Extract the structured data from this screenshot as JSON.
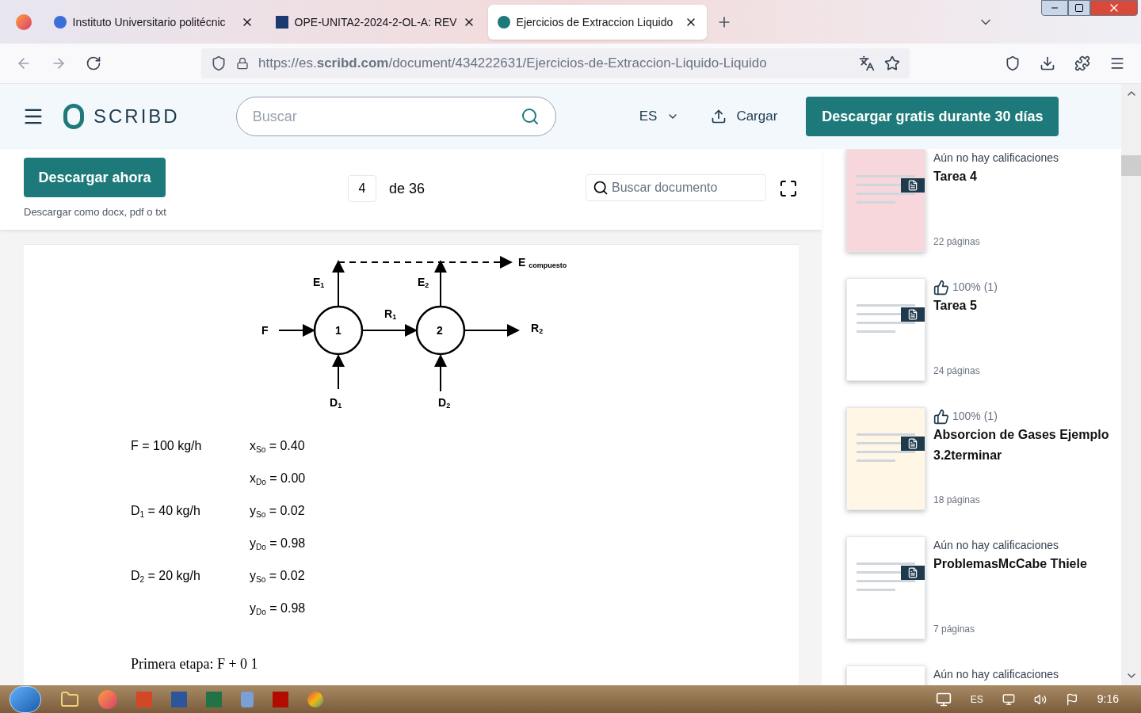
{
  "browser": {
    "tabs": [
      {
        "title": "Instituto Universitario politécnic",
        "selected": false
      },
      {
        "title": "OPE-UNITA2-2024-2-OL-A: REV",
        "selected": false
      },
      {
        "title": "Ejercicios de Extraccion Liquido",
        "selected": true
      }
    ],
    "url": "https://es.**scribd.com**/document/434222631/Ejercicios-de-Extraccion-Liquido-Liquido"
  },
  "header": {
    "logo": "SCRIBD",
    "search_placeholder": "Buscar",
    "language": "ES",
    "upload": "Cargar",
    "cta": "Descargar gratis durante 30 días"
  },
  "toolbar": {
    "download": "Descargar ahora",
    "download_note": "Descargar como docx, pdf o txt",
    "page": "4",
    "page_total": "de 36",
    "doc_search_placeholder": "Buscar documento"
  },
  "document": {
    "diagram": {
      "feed": "F",
      "stages": [
        "1",
        "2"
      ],
      "extracts": [
        "E$_{1}$",
        "E$_{2}$"
      ],
      "raffinates": [
        "R$_{1}$",
        "R$_{2}$"
      ],
      "solvents": [
        "D$_{1}$",
        "D$_{2}$"
      ],
      "combined": "E $_{compuesto}$"
    },
    "rows": [
      {
        "left": "F = 100 kg/h",
        "right": "x$_{So}$ = 0.40"
      },
      {
        "left": "",
        "right": "x$_{Do}$ = 0.00"
      },
      {
        "left": "D$_{1}$ = 40 kg/h",
        "right": "y$_{So}$ = 0.02"
      },
      {
        "left": "",
        "right": "y$_{Do}$ = 0.98"
      },
      {
        "left": "D$_{2}$ = 20 kg/h",
        "right": "y$_{So}$ = 0.02"
      },
      {
        "left": "",
        "right": "y$_{Do}$ = 0.98"
      }
    ],
    "paragraph": "Primera etapa: F + 0 1"
  },
  "sidebar": [
    {
      "kind": "unrated",
      "rating": "Aún no hay calificaciones",
      "title": "Tarea 4",
      "pages": "22 páginas"
    },
    {
      "kind": "liked",
      "rating": "100% (1)",
      "title": "Tarea 5",
      "pages": "24 páginas"
    },
    {
      "kind": "liked",
      "rating": "100% (1)",
      "title": "Absorcion de Gases Ejemplo 3.2terminar",
      "pages": "18 páginas"
    },
    {
      "kind": "unrated",
      "rating": "Aún no hay calificaciones",
      "title": "ProblemasMcCabe Thiele",
      "pages": "7 páginas"
    },
    {
      "kind": "unrated",
      "rating": "Aún no hay calificaciones"
    }
  ],
  "taskbar": {
    "language": "ES",
    "time": "9:16"
  }
}
